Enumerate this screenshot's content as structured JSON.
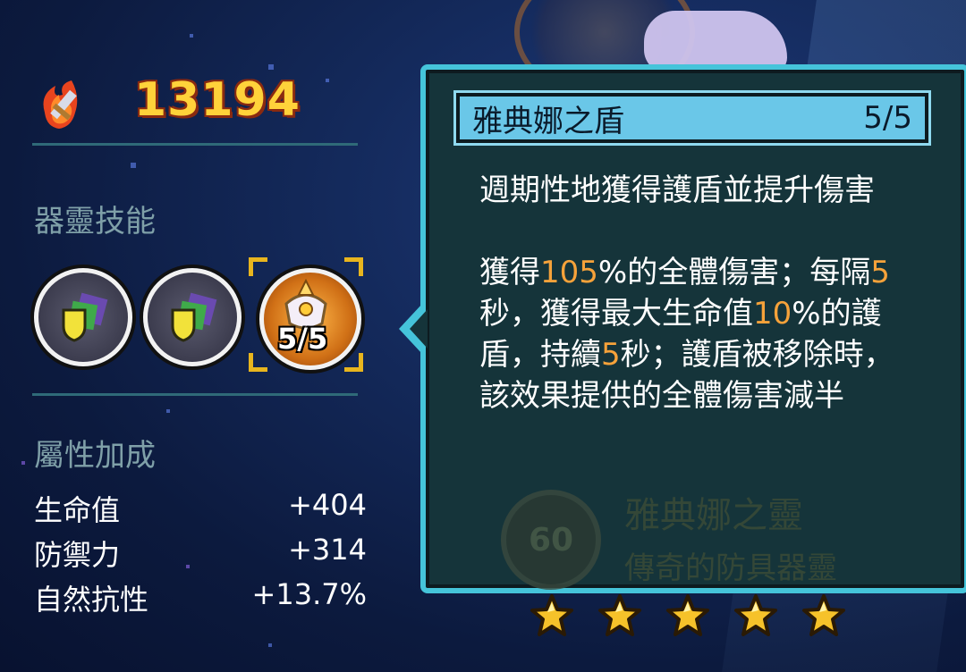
{
  "power": {
    "value": "13194",
    "icon": "flaming-sword-icon"
  },
  "skills_section": {
    "title": "器靈技能",
    "selected_level": "5/5"
  },
  "stats_section": {
    "title": "屬性加成",
    "rows": [
      {
        "label": "生命值",
        "value": "+404"
      },
      {
        "label": "防禦力",
        "value": "+314"
      },
      {
        "label": "自然抗性",
        "value": "+13.7%"
      }
    ]
  },
  "tooltip": {
    "title": "雅典娜之盾",
    "level": "5/5",
    "summary": "週期性地獲得護盾並提升傷害",
    "detail": {
      "p1": "獲得",
      "v1": "105",
      "p2": "%的全體傷害；每隔",
      "v2": "5",
      "p3": "秒，獲得最大生命值",
      "v3": "10",
      "p4": "%的護盾，持續",
      "v4": "5",
      "p5": "秒；護盾被移除時，該效果提供的全體傷害減半"
    }
  },
  "background": {
    "spirit_name": "雅典娜之靈",
    "spirit_type": "傳奇的防具器靈",
    "level_badge": "60"
  },
  "rating": {
    "stars": 5
  },
  "colors": {
    "accent": "#45c4da",
    "highlight": "#f6a23a",
    "power": "#ffd23a"
  }
}
